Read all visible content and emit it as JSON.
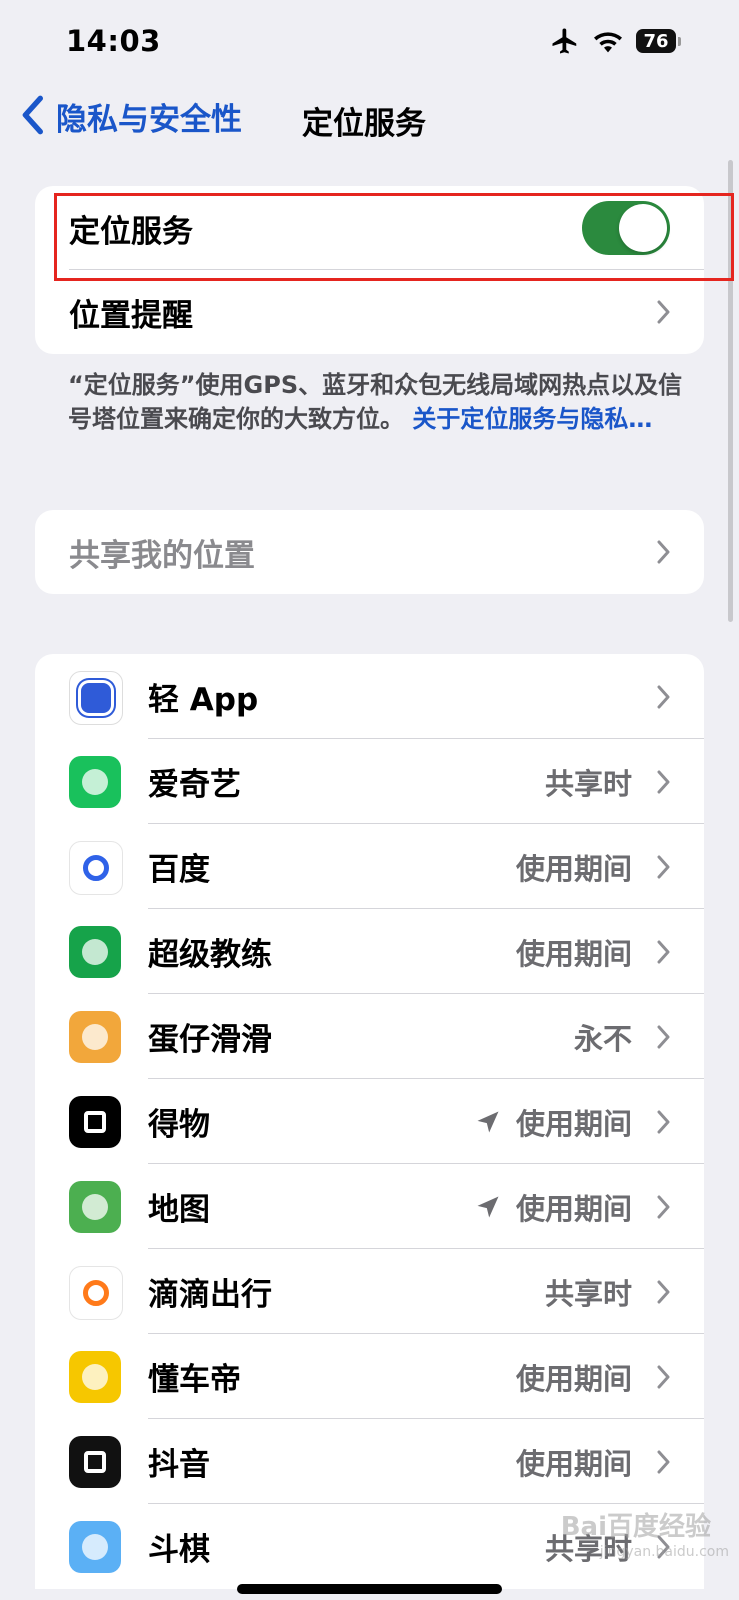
{
  "status_bar": {
    "time": "14:03",
    "battery": "76"
  },
  "nav": {
    "back_label": "隐私与安全性",
    "title": "定位服务"
  },
  "location_group": {
    "toggle_label": "定位服务",
    "toggle_on": true,
    "alert_label": "位置提醒"
  },
  "footer": {
    "text": "“定位服务”使用GPS、蓝牙和众包无线局域网热点以及信号塔位置来确定你的大致方位。",
    "link": "关于定位服务与隐私…"
  },
  "share": {
    "label": "共享我的位置"
  },
  "apps": [
    {
      "name": "轻 App",
      "status": "",
      "arrow": false,
      "icon": "light-app-icon",
      "color": "#2f5bd8"
    },
    {
      "name": "爱奇艺",
      "status": "共享时",
      "arrow": false,
      "icon": "iqiyi-icon",
      "color": "#19c15c"
    },
    {
      "name": "百度",
      "status": "使用期间",
      "arrow": false,
      "icon": "baidu-icon",
      "color": "#2f62e8"
    },
    {
      "name": "超级教练",
      "status": "使用期间",
      "arrow": false,
      "icon": "super-coach-icon",
      "color": "#16a34a"
    },
    {
      "name": "蛋仔滑滑",
      "status": "永不",
      "arrow": false,
      "icon": "eggy-icon",
      "color": "#f2a73b"
    },
    {
      "name": "得物",
      "status": "使用期间",
      "arrow": true,
      "icon": "dewu-icon",
      "color": "#000000"
    },
    {
      "name": "地图",
      "status": "使用期间",
      "arrow": true,
      "icon": "maps-icon",
      "color": "#4caf50"
    },
    {
      "name": "滴滴出行",
      "status": "共享时",
      "arrow": false,
      "icon": "didi-icon",
      "color": "#ff7a1a"
    },
    {
      "name": "懂车帝",
      "status": "使用期间",
      "arrow": false,
      "icon": "dongchedi-icon",
      "color": "#f6c700"
    },
    {
      "name": "抖音",
      "status": "使用期间",
      "arrow": false,
      "icon": "douyin-icon",
      "color": "#111111"
    },
    {
      "name": "斗棋",
      "status": "共享时",
      "arrow": false,
      "icon": "douqi-icon",
      "color": "#5bb0f5"
    }
  ],
  "watermark": {
    "text": "Bai百度经验",
    "sub": "jingyan.baidu.com"
  }
}
